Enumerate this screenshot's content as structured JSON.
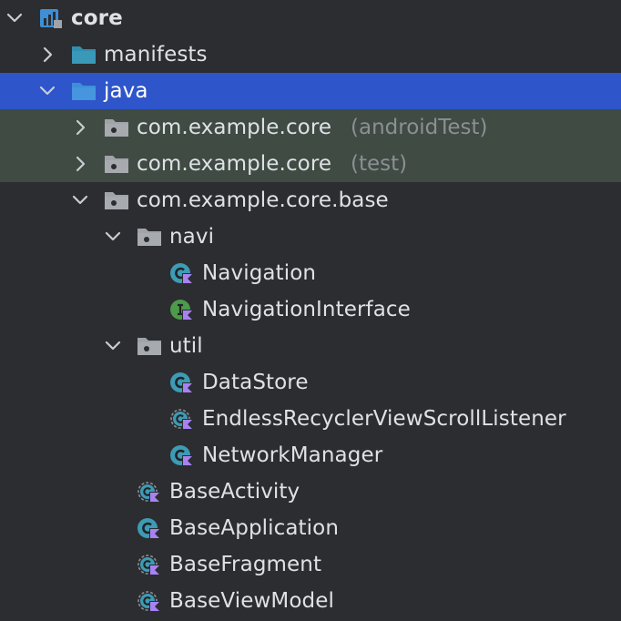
{
  "project_tree": {
    "root": {
      "label": "core",
      "expanded": true
    },
    "manifests": {
      "label": "manifests",
      "expanded": false
    },
    "java": {
      "label": "java",
      "expanded": true,
      "selected": true
    },
    "pkg_android_test": {
      "label": "com.example.core",
      "suffix": "(androidTest)",
      "expanded": false
    },
    "pkg_test": {
      "label": "com.example.core",
      "suffix": "(test)",
      "expanded": false
    },
    "pkg_base": {
      "label": "com.example.core.base",
      "expanded": true
    },
    "navi": {
      "label": "navi",
      "expanded": true
    },
    "navigation": {
      "label": "Navigation",
      "kind": "kotlin-class"
    },
    "navigation_interface": {
      "label": "NavigationInterface",
      "kind": "kotlin-interface"
    },
    "util": {
      "label": "util",
      "expanded": true
    },
    "data_store": {
      "label": "DataStore",
      "kind": "kotlin-class"
    },
    "endless_listener": {
      "label": "EndlessRecyclerViewScrollListener",
      "kind": "kotlin-abstract-class"
    },
    "network_manager": {
      "label": "NetworkManager",
      "kind": "kotlin-class"
    },
    "base_activity": {
      "label": "BaseActivity",
      "kind": "kotlin-abstract-class"
    },
    "base_application": {
      "label": "BaseApplication",
      "kind": "kotlin-class"
    },
    "base_fragment": {
      "label": "BaseFragment",
      "kind": "kotlin-abstract-class"
    },
    "base_view_model": {
      "label": "BaseViewModel",
      "kind": "kotlin-abstract-class"
    }
  },
  "colors": {
    "background": "#2b2d30",
    "selection": "#2e55c9",
    "test_source_highlight": "#3f4b43",
    "folder_blue": "#3e8fd6",
    "package_gray": "#a0a3a8",
    "kotlin_class_teal": "#3d9bb4",
    "kotlin_interface_green": "#4c9a4a",
    "kotlin_badge_purple": "#a882f2"
  }
}
